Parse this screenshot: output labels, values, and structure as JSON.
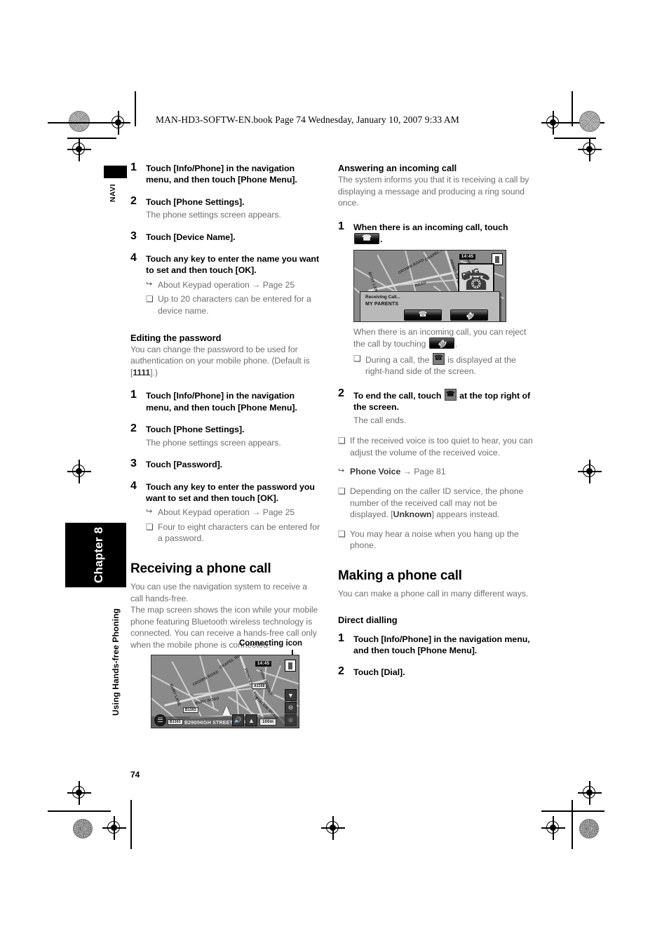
{
  "document": {
    "header_line": "MAN-HD3-SOFTW-EN.book  Page 74  Wednesday, January 10, 2007  9:33 AM",
    "page_number": "74",
    "navi_tab": "NAVI",
    "chapter_tab": "Chapter 8",
    "side_running_head": "Using Hands-free Phoning"
  },
  "left_column": {
    "steps_device_name": [
      {
        "num": "1",
        "text": "Touch [Info/Phone] in the navigation menu, and then touch [Phone Menu]."
      },
      {
        "num": "2",
        "text": "Touch [Phone Settings].",
        "sub": "The phone settings screen appears."
      },
      {
        "num": "3",
        "text": "Touch [Device Name]."
      },
      {
        "num": "4",
        "text": "Touch any key to enter the name you want to set and then touch [OK]."
      }
    ],
    "device_name_notes": [
      {
        "glyph": "↪",
        "text": "About Keypad operation → Page 25"
      },
      {
        "glyph": "❑",
        "text": "Up to 20 characters can be entered for a device name."
      }
    ],
    "editing_password": {
      "heading": "Editing the password",
      "intro_a": "You can change the password to be used for authentication on your mobile phone. (Default is [",
      "intro_bold": "1111",
      "intro_b": "].)",
      "steps": [
        {
          "num": "1",
          "text": "Touch [Info/Phone] in the navigation menu, and then touch [Phone Menu]."
        },
        {
          "num": "2",
          "text": "Touch [Phone Settings].",
          "sub": "The phone settings screen appears."
        },
        {
          "num": "3",
          "text": "Touch [Password]."
        },
        {
          "num": "4",
          "text": "Touch any key to enter the password you want to set and then touch [OK]."
        }
      ],
      "notes": [
        {
          "glyph": "↪",
          "text": "About Keypad operation → Page 25"
        },
        {
          "glyph": "❑",
          "text": "Four to eight characters can be entered for a password."
        }
      ]
    },
    "receiving_call": {
      "heading": "Receiving a phone call",
      "para1": "You can use the navigation system to receive a call hands-free.",
      "para2": "The map screen shows the icon while your mobile phone featuring Bluetooth wireless technology is connected. You can receive a hands-free call only when the mobile phone is connected."
    },
    "map_caption": "Connecting icon"
  },
  "right_column": {
    "answering": {
      "heading": "Answering an incoming call",
      "intro": "The system informs you that it is receiving a call by displaying a message and producing a ring sound once.",
      "step1_num": "1",
      "step1_text_a": "When there is an incoming call, touch",
      "step1_text_b": ".",
      "after_map_a": "When there is an incoming call, you can reject the call by touching",
      "after_map_b": ".",
      "note_during_a": "During a call, the",
      "note_during_b": "is displayed at the right-hand side of the screen.",
      "step2_num": "2",
      "step2_a": "To end the call, touch",
      "step2_b": "at the top right of the screen.",
      "step2_sub": "The call ends."
    },
    "notes": [
      {
        "glyph": "❑",
        "text": "If the received voice is too quiet to hear, you can adjust the volume of the received voice."
      },
      {
        "glyph": "↪",
        "bold": "Phone Voice",
        "text": " → Page 81"
      },
      {
        "glyph": "❑",
        "text_a": "Depending on the caller ID service, the phone number of the received call may not be displayed. [",
        "bold": "Unknown",
        "text_b": "] appears instead."
      },
      {
        "glyph": "❑",
        "text": "You may hear a noise when you hang up the phone."
      }
    ],
    "making": {
      "heading": "Making a phone call",
      "para": "You can make a phone call in many different ways.",
      "subheading": "Direct dialling",
      "steps": [
        {
          "num": "1",
          "text": "Touch [Info/Phone] in the navigation menu, and then touch [Phone Menu]."
        },
        {
          "num": "2",
          "text": "Touch [Dial]."
        }
      ]
    }
  },
  "map_incoming": {
    "clock": "14:45",
    "dialog_title": "Receiving Call...",
    "dialog_caller": "MY PARENTS",
    "ring_word": "RING",
    "road_labels": [
      "CHAPEL ROAD",
      "CROWN ROAD",
      "PRINCESS LANE",
      "HIGH STREET",
      "ROAD",
      "BURY LANE"
    ]
  },
  "map_connecting": {
    "clock": "14:45",
    "road_labels": [
      "CHAPEL ROAD",
      "CROWN ROAD",
      "PRINCESS LANE",
      "HIGH STREET",
      "BURY LANE",
      "BURY ROAD",
      "STATION ROAD"
    ],
    "shield_a": "B1393",
    "shield_b": "A1168",
    "shield_c": "B1393",
    "street_bar": "B290/HIGH STREET (EPPING)",
    "scale": "100",
    "scale_unit": "m"
  }
}
